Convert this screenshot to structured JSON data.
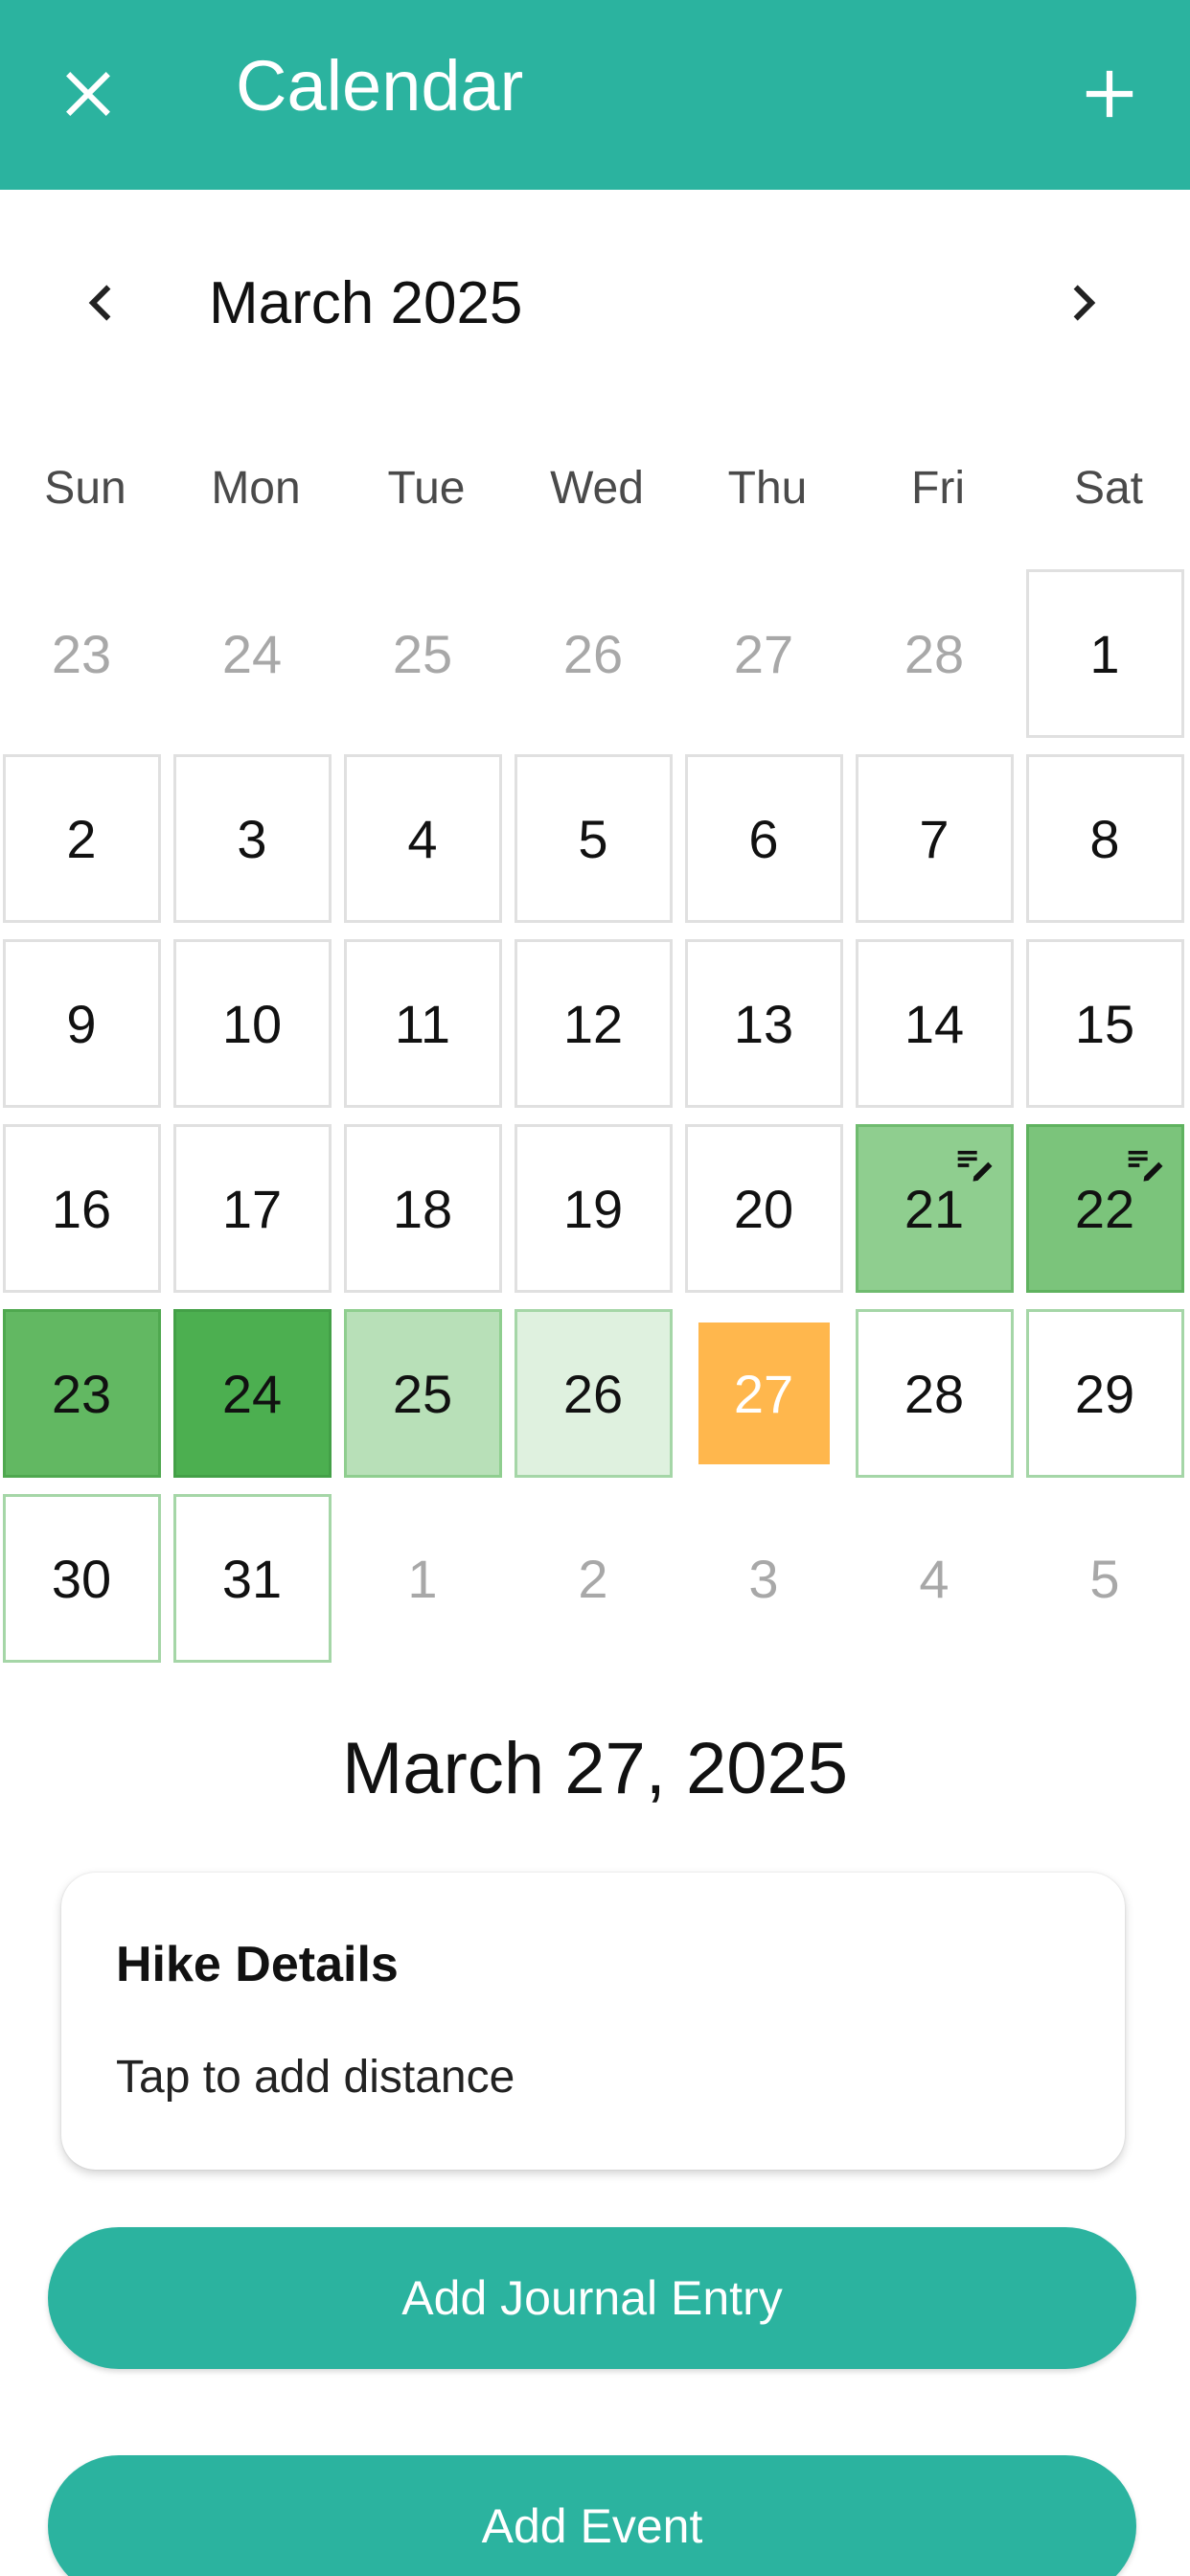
{
  "appbar": {
    "title": "Calendar",
    "background": "#2bb39f",
    "close_icon": "close-icon",
    "add_icon": "plus-icon"
  },
  "month_nav": {
    "label": "March 2025",
    "prev_icon": "chevron-left-icon",
    "next_icon": "chevron-right-icon"
  },
  "weekdays": [
    "Sun",
    "Mon",
    "Tue",
    "Wed",
    "Thu",
    "Fri",
    "Sat"
  ],
  "calendar": {
    "weeks": [
      [
        {
          "day": "23",
          "in_month": false
        },
        {
          "day": "24",
          "in_month": false
        },
        {
          "day": "25",
          "in_month": false
        },
        {
          "day": "26",
          "in_month": false
        },
        {
          "day": "27",
          "in_month": false
        },
        {
          "day": "28",
          "in_month": false
        },
        {
          "day": "1",
          "in_month": true
        }
      ],
      [
        {
          "day": "2",
          "in_month": true
        },
        {
          "day": "3",
          "in_month": true
        },
        {
          "day": "4",
          "in_month": true
        },
        {
          "day": "5",
          "in_month": true
        },
        {
          "day": "6",
          "in_month": true
        },
        {
          "day": "7",
          "in_month": true
        },
        {
          "day": "8",
          "in_month": true
        }
      ],
      [
        {
          "day": "9",
          "in_month": true
        },
        {
          "day": "10",
          "in_month": true
        },
        {
          "day": "11",
          "in_month": true
        },
        {
          "day": "12",
          "in_month": true
        },
        {
          "day": "13",
          "in_month": true
        },
        {
          "day": "14",
          "in_month": true
        },
        {
          "day": "15",
          "in_month": true
        }
      ],
      [
        {
          "day": "16",
          "in_month": true
        },
        {
          "day": "17",
          "in_month": true
        },
        {
          "day": "18",
          "in_month": true
        },
        {
          "day": "19",
          "in_month": true
        },
        {
          "day": "20",
          "in_month": true
        },
        {
          "day": "21",
          "in_month": true,
          "fill": "#8fce8f",
          "border": "#6fbb6f",
          "has_note": true
        },
        {
          "day": "22",
          "in_month": true,
          "fill": "#7bc47b",
          "border": "#5fb25f",
          "has_note": true
        }
      ],
      [
        {
          "day": "23",
          "in_month": true,
          "fill": "#62b862",
          "border": "#4fa84f"
        },
        {
          "day": "24",
          "in_month": true,
          "fill": "#4caf50",
          "border": "#43a047"
        },
        {
          "day": "25",
          "in_month": true,
          "fill": "#b8e0b8",
          "border": "#8fce8f"
        },
        {
          "day": "26",
          "in_month": true,
          "fill": "#dff1df",
          "border": "#a5d6a7"
        },
        {
          "day": "27",
          "in_month": true,
          "selected": true,
          "fill": "#ffb74d",
          "text_color": "#ffffff"
        },
        {
          "day": "28",
          "in_month": true,
          "border": "#a5d6a7"
        },
        {
          "day": "29",
          "in_month": true,
          "border": "#a5d6a7"
        }
      ],
      [
        {
          "day": "30",
          "in_month": true,
          "border": "#a5d6a7"
        },
        {
          "day": "31",
          "in_month": true,
          "border": "#a5d6a7"
        },
        {
          "day": "1",
          "in_month": false
        },
        {
          "day": "2",
          "in_month": false
        },
        {
          "day": "3",
          "in_month": false
        },
        {
          "day": "4",
          "in_month": false
        },
        {
          "day": "5",
          "in_month": false
        }
      ]
    ],
    "note_icon": "edit-note-icon"
  },
  "selected_date": "March 27, 2025",
  "hike_card": {
    "title": "Hike Details",
    "subtitle": "Tap to add distance"
  },
  "buttons": {
    "journal": "Add Journal Entry",
    "event": "Add Event"
  }
}
